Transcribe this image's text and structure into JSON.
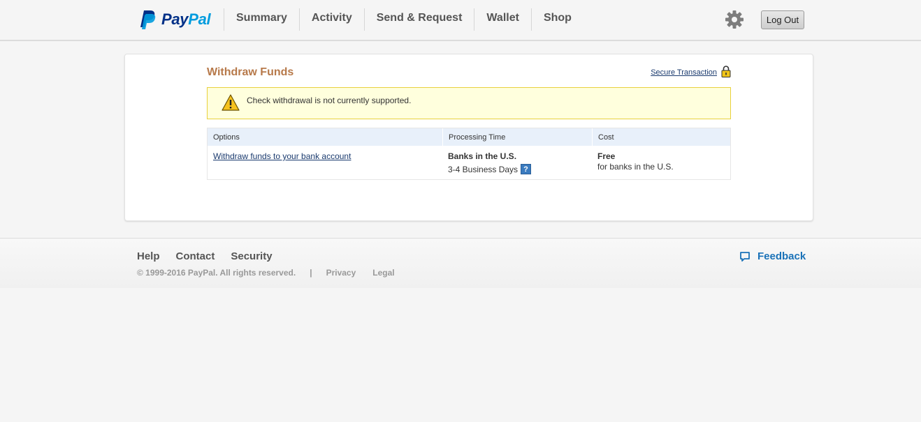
{
  "brand": {
    "name_pay": "Pay",
    "name_pal": "Pal"
  },
  "nav": {
    "items": [
      "Summary",
      "Activity",
      "Send & Request",
      "Wallet",
      "Shop"
    ],
    "logout_label": "Log Out"
  },
  "main": {
    "title": "Withdraw Funds",
    "secure_link": "Secure Transaction",
    "alert": "Check withdrawal is not currently supported.",
    "table": {
      "headers": [
        "Options",
        "Processing Time",
        "Cost"
      ],
      "rows": [
        {
          "option": "Withdraw funds to your bank account",
          "time_title": "Banks in the U.S.",
          "time_detail": "3-4 Business Days",
          "help": "?",
          "cost_title": "Free",
          "cost_detail": "for banks in the U.S."
        }
      ]
    }
  },
  "footer": {
    "links": [
      "Help",
      "Contact",
      "Security"
    ],
    "copyright": "© 1999-2016 PayPal. All rights reserved.",
    "separator": "|",
    "legal_links": [
      "Privacy",
      "Legal"
    ],
    "feedback": "Feedback"
  },
  "icons": {
    "logo": "paypal-logo-icon",
    "settings": "gear-icon",
    "lock": "lock-icon",
    "warning": "warning-icon",
    "help": "help-icon",
    "feedback": "feedback-icon"
  },
  "colors": {
    "title": "#b7794a",
    "link": "#1a3a6e",
    "alert_bg": "#ffffdd",
    "alert_border": "#e8d13d",
    "table_header_bg": "#e8f0fa",
    "feedback": "#1a72b8",
    "paypal_dark": "#003087",
    "paypal_light": "#009cde"
  }
}
